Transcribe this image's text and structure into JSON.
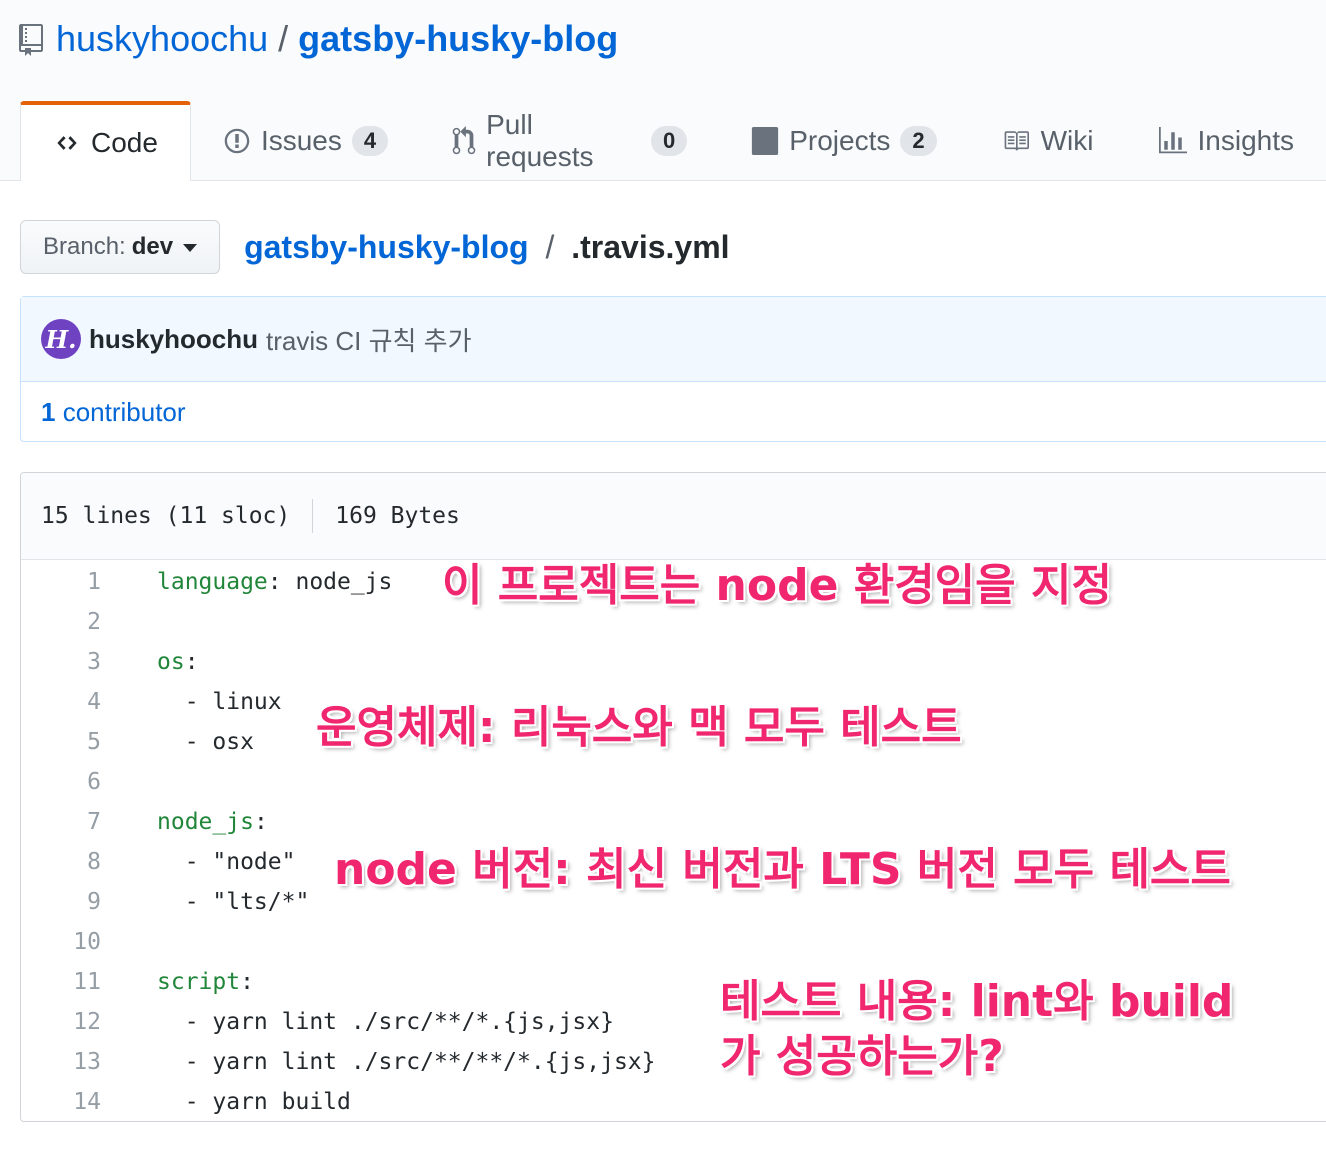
{
  "repo": {
    "owner": "huskyhoochu",
    "separator": "/",
    "name": "gatsby-husky-blog",
    "icon": "repo-icon"
  },
  "tabs": [
    {
      "label": "Code",
      "icon": "code-icon",
      "selected": true
    },
    {
      "label": "Issues",
      "icon": "issue-icon",
      "count": "4"
    },
    {
      "label": "Pull requests",
      "icon": "pull-request-icon",
      "count": "0"
    },
    {
      "label": "Projects",
      "icon": "project-icon",
      "count": "2"
    },
    {
      "label": "Wiki",
      "icon": "book-icon"
    },
    {
      "label": "Insights",
      "icon": "graph-icon"
    }
  ],
  "branch": {
    "label": "Branch:",
    "name": "dev"
  },
  "breadcrumb": {
    "repo": "gatsby-husky-blog",
    "separator": "/",
    "file": ".travis.yml"
  },
  "commit": {
    "author": "huskyhoochu",
    "message": "travis CI 규칙 추가",
    "avatar_text": "H.",
    "contributors_count": "1",
    "contributors_label": "contributor"
  },
  "file": {
    "lines_info": "15 lines (11 sloc)",
    "size": "169 Bytes",
    "lines": [
      {
        "n": "1",
        "key": "language",
        "rest": ": node_js"
      },
      {
        "n": "2",
        "key": "",
        "rest": ""
      },
      {
        "n": "3",
        "key": "os",
        "rest": ":"
      },
      {
        "n": "4",
        "key": "",
        "rest": "  - linux"
      },
      {
        "n": "5",
        "key": "",
        "rest": "  - osx"
      },
      {
        "n": "6",
        "key": "",
        "rest": ""
      },
      {
        "n": "7",
        "key": "node_js",
        "rest": ":"
      },
      {
        "n": "8",
        "key": "",
        "rest": "  - \"node\""
      },
      {
        "n": "9",
        "key": "",
        "rest": "  - \"lts/*\""
      },
      {
        "n": "10",
        "key": "",
        "rest": ""
      },
      {
        "n": "11",
        "key": "script",
        "rest": ":"
      },
      {
        "n": "12",
        "key": "",
        "rest": "  - yarn lint ./src/**/*.{js,jsx}"
      },
      {
        "n": "13",
        "key": "",
        "rest": "  - yarn lint ./src/**/**/*.{js,jsx}"
      },
      {
        "n": "14",
        "key": "",
        "rest": "  - yarn build"
      }
    ]
  },
  "annotations": {
    "note_language": "이 프로젝트는 node 환경임을 지정",
    "note_os": "운영체제: 리눅스와 맥 모두 테스트",
    "note_node": "node 버전: 최신 버전과 LTS 버전 모두 테스트",
    "note_script_line1": "테스트 내용: lint와 build",
    "note_script_line2": "가 성공하는가?",
    "color": "#f0266e"
  },
  "colors": {
    "link": "#0366d6",
    "selected_tab_accent": "#e36209",
    "commit_bg": "#f1f8ff",
    "yaml_key": "#22863a",
    "avatar_bg": "#6f42c1"
  }
}
